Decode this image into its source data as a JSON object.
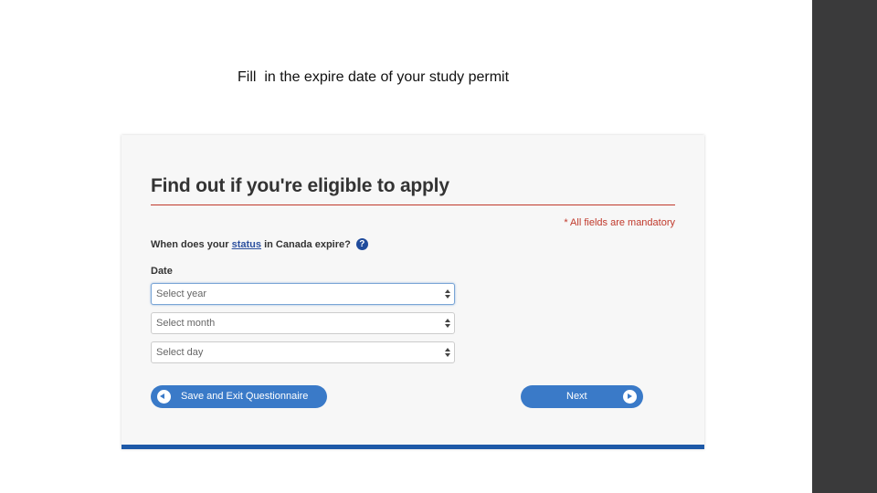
{
  "caption": "Fill  in the expire date of your study permit",
  "form": {
    "heading": "Find out if you're eligible to apply",
    "mandatory_note": "* All fields are mandatory",
    "question_prefix": "When does your ",
    "question_link": "status",
    "question_suffix": " in Canada expire?",
    "help_icon_glyph": "?",
    "date_label": "Date",
    "selects": {
      "year_placeholder": "Select year",
      "month_placeholder": "Select month",
      "day_placeholder": "Select day"
    },
    "buttons": {
      "save_exit": "Save and Exit Questionnaire",
      "next": "Next"
    }
  },
  "colors": {
    "accent_blue": "#3a7ac8",
    "rule_red": "#c0392b",
    "footer_blue": "#1e5aa8",
    "sidebar_dark": "#3a3a3b"
  },
  "icons": {
    "back": "chevron-left-circle-icon",
    "next": "chevron-right-circle-icon",
    "help": "question-circle-icon",
    "select_arrows": "sort-arrows-icon"
  }
}
